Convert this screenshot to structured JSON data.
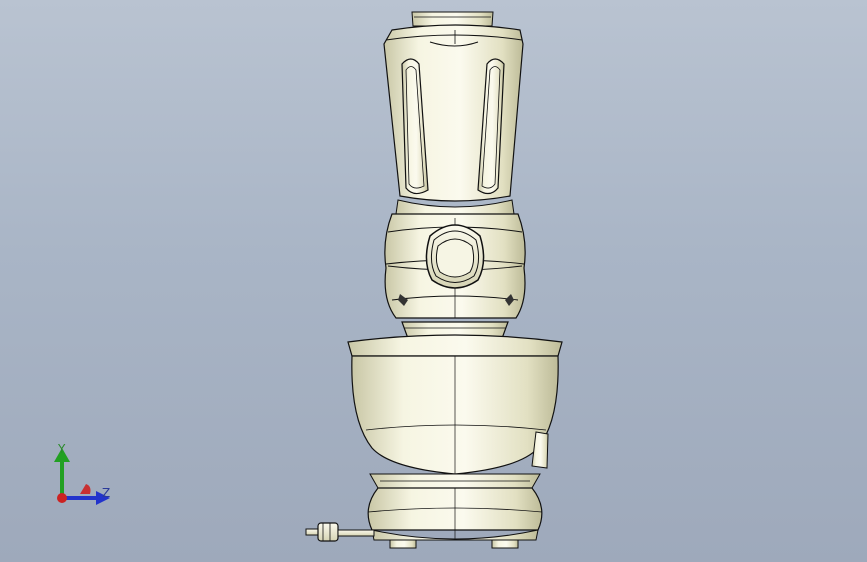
{
  "viewport": {
    "background_top": "#b9c3d1",
    "background_bottom": "#9ea9bb"
  },
  "model": {
    "name": "stand-mixer-blender",
    "surface_color": "#efeed6",
    "edge_color": "#1a1a1a"
  },
  "triad": {
    "y_label": "Y",
    "z_label": "Z",
    "y_color": "#22a022",
    "z_color": "#2233cc",
    "x_color": "#cc2222"
  }
}
